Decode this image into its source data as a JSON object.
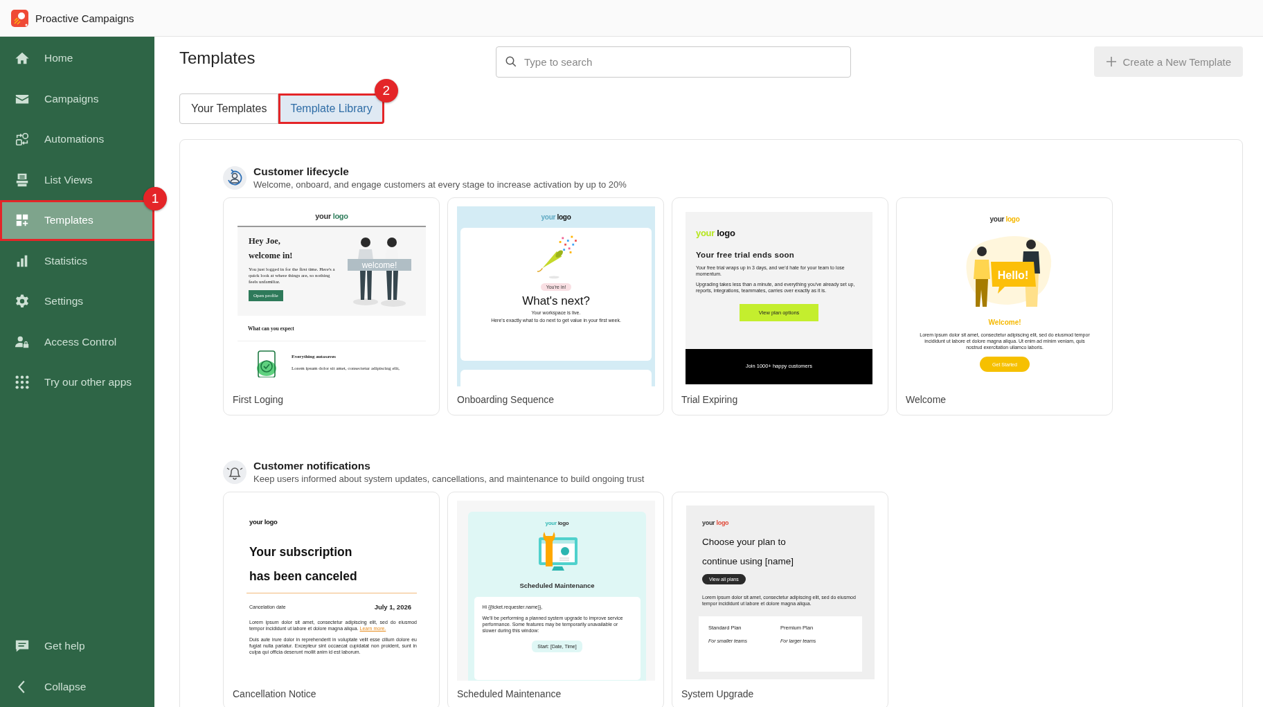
{
  "app": {
    "name": "Proactive Campaigns"
  },
  "sidebar": {
    "items": [
      {
        "label": "Home",
        "kind": "home",
        "selected": false
      },
      {
        "label": "Campaigns",
        "kind": "mail",
        "selected": false
      },
      {
        "label": "Automations",
        "kind": "automation",
        "selected": false
      },
      {
        "label": "List Views",
        "kind": "list",
        "selected": false
      },
      {
        "label": "Templates",
        "kind": "templates",
        "selected": true,
        "callout": "1"
      },
      {
        "label": "Statistics",
        "kind": "stats",
        "selected": false
      },
      {
        "label": "Settings",
        "kind": "settings",
        "selected": false
      },
      {
        "label": "Access Control",
        "kind": "access",
        "selected": false
      },
      {
        "label": "Try our other apps",
        "kind": "apps",
        "selected": false
      }
    ],
    "footer": [
      {
        "label": "Get help",
        "kind": "help"
      },
      {
        "label": "Collapse",
        "kind": "collapse"
      }
    ]
  },
  "page": {
    "title": "Templates",
    "search": {
      "placeholder": "Type to search"
    },
    "create_button": {
      "label": "Create a New Template",
      "disabled": true
    }
  },
  "tabs": [
    {
      "label": "Your Templates",
      "selected": false
    },
    {
      "label": "Template Library",
      "selected": true,
      "callout": "2"
    }
  ],
  "sections": [
    {
      "kind": "lifecycle",
      "title": "Customer lifecycle",
      "subtitle": "Welcome, onboard, and engage customers at every stage to increase activation by up to 20%",
      "templates": [
        {
          "label": "First Loging",
          "preview": {
            "kind": "hero-split",
            "logo": [
              "your",
              "logo"
            ],
            "heading": [
              "Hey Joe,",
              "welcome in!"
            ],
            "intro": "You just logged in for the first time. Here's a quick look at where things are, so nothing feels unfamiliar.",
            "button": "Open profile",
            "sign": "welcome!",
            "subheading": "What can you expect",
            "feature_title": "Everything autosaves",
            "feature_text": "Lorem ipsum dolor sit amet, consectetur adipiscing elit,"
          }
        },
        {
          "label": "Onboarding Sequence",
          "preview": {
            "kind": "celebration",
            "logo": [
              "your",
              "logo"
            ],
            "pill": "You're in!",
            "heading": "What's next?",
            "lines": [
              "Your workspace is live.",
              "Here's exactly what to do next to get value in your first week."
            ]
          }
        },
        {
          "label": "Trial Expiring",
          "preview": {
            "kind": "trial",
            "logo": [
              "your",
              "logo"
            ],
            "heading": "Your free trial ends soon",
            "paragraphs": [
              "Your free trial wraps up in 3 days, and we'd hate for your team to lose momentum.",
              "Upgrading takes less than a minute, and everything you've already set up, reports, integrations, teammates, carries over exactly as it is."
            ],
            "button": "View plan options",
            "footer": "Join 1000+ happy customers"
          }
        },
        {
          "label": "Welcome",
          "preview": {
            "kind": "hello",
            "logo": [
              "your",
              "logo"
            ],
            "bubble": "Hello!",
            "heading": "Welcome!",
            "text": "Lorem ipsum dolor sit amet, consectetur adipiscing elit, sed do eiusmod tempor incididunt ut labore et dolore magna aliqua. Ut enim ad minim veniam, quis nostrud exercitation ullamco laboris.",
            "button": "Get Started"
          }
        }
      ]
    },
    {
      "kind": "bell",
      "title": "Customer notifications",
      "subtitle": "Keep users informed about system updates, cancellations, and maintenance to build ongoing trust",
      "templates": [
        {
          "label": "Cancellation Notice",
          "preview": {
            "kind": "cancellation",
            "logo": [
              "your",
              "logo"
            ],
            "heading": [
              "Your subscription",
              "has been canceled"
            ],
            "date_label": "Cancelation date",
            "date": "July 1, 2026",
            "paragraphs": [
              {
                "text": "Lorem ipsum dolor sit amet, consectetur adipiscing elit, sed do eiusmod tempor incididunt ut labore et dolore magna aliqua.",
                "link": "Learn more."
              },
              {
                "text": "Duis aute irure dolor in reprehenderit in voluptate velit esse cillum dolore eu fugiat nulla pariatur. Excepteur sint occaecat cupidatat non proident, sunt in culpa qui officia deserunt mollit anim id est laborum."
              }
            ]
          }
        },
        {
          "label": "Scheduled Maintenance",
          "preview": {
            "kind": "maintenance",
            "logo": [
              "your",
              "logo"
            ],
            "heading": "Scheduled Maintenance",
            "greeting": "Hi {{ticket.requester.name}},",
            "text": "We'll be performing a planned system upgrade to improve service performance. Some features may be temporarily unavailable or slower during this window:",
            "pill": "Start: [Date, Time]"
          }
        },
        {
          "label": "System Upgrade",
          "preview": {
            "kind": "plans",
            "logo": [
              "your",
              "logo"
            ],
            "heading": [
              "Choose your plan to",
              "continue using [name]"
            ],
            "button": "View all plans",
            "text": "Lorem ipsum dolor sit amet, consectetur adipiscing elit, sed do eiusmod tempor incididunt ut labore et dolore magna aliqua.",
            "plans": [
              {
                "name": "Standard Plan",
                "note": "For smaller teams"
              },
              {
                "name": "Premium Plan",
                "note": "For larger teams"
              }
            ]
          }
        }
      ]
    }
  ]
}
